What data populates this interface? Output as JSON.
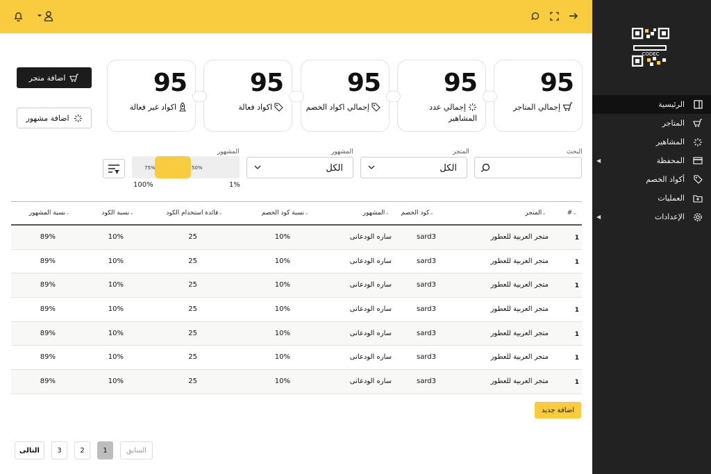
{
  "sidebar": {
    "logo_text": "كودك CODEC",
    "items": [
      {
        "label": "الرئيسية",
        "icon": "layout-icon",
        "active": true
      },
      {
        "label": "المتاجر",
        "icon": "cart-icon"
      },
      {
        "label": "المشاهير",
        "icon": "loader-icon"
      },
      {
        "label": "المحفظة",
        "icon": "wallet-icon",
        "expandable": true
      },
      {
        "label": "أكواد الخصم",
        "icon": "tag-icon"
      },
      {
        "label": "العمليات",
        "icon": "folder-icon"
      },
      {
        "label": "الإعدادات",
        "icon": "gear-icon",
        "expandable": true
      }
    ]
  },
  "header": {
    "icons_right": [
      "arrow-right-icon",
      "fullscreen-icon",
      "search-icon"
    ],
    "icons_left": [
      "user-icon",
      "bell-icon"
    ]
  },
  "cards": [
    {
      "value": "95",
      "label": "إجمالي المتاجر",
      "icon": "cart-icon"
    },
    {
      "value": "95",
      "label": "إجمالي عدد المشاهير",
      "icon": "loader-icon"
    },
    {
      "value": "95",
      "label": "إجمالي اكواد الخصم",
      "icon": "tag-icon"
    },
    {
      "value": "95",
      "label": "اكواد فعالة",
      "icon": "tag-icon"
    },
    {
      "value": "95",
      "label": "اكواد غير فعالة",
      "icon": "rocket-icon"
    }
  ],
  "actions": {
    "add_store": "اضافة متجر",
    "add_celebrity": "اضافة مشهور"
  },
  "filters": {
    "search_label": "البحث",
    "store_label": "المتجر",
    "store_value": "الكل",
    "celebrity_label": "المشهور",
    "celebrity_value": "الكل",
    "range_label": "المشهور",
    "range_low_text": "50%",
    "range_high_text": "75%",
    "range_min": "1%",
    "range_max": "100%"
  },
  "table": {
    "headers": [
      "#",
      "المتجر",
      "كود الخصم",
      "المشهور",
      "نسبة كود الخصم",
      "فائدة استخدام الكود",
      "نسبة الكود",
      "نسبة المشهور"
    ],
    "rows": [
      [
        "1",
        "متجر العربية للعطور",
        "sard3",
        "ساره الودعانى",
        "10%",
        "25",
        "10%",
        "89%"
      ],
      [
        "1",
        "متجر العربية للعطور",
        "sard3",
        "ساره الودعانى",
        "10%",
        "25",
        "10%",
        "89%"
      ],
      [
        "1",
        "متجر العربية للعطور",
        "sard3",
        "ساره الودعانى",
        "10%",
        "25",
        "10%",
        "89%"
      ],
      [
        "1",
        "متجر العربية للعطور",
        "sard3",
        "ساره الودعانى",
        "10%",
        "25",
        "10%",
        "89%"
      ],
      [
        "1",
        "متجر العربية للعطور",
        "sard3",
        "ساره الودعانى",
        "10%",
        "25",
        "10%",
        "89%"
      ],
      [
        "1",
        "متجر العربية للعطور",
        "sard3",
        "ساره الودعانى",
        "10%",
        "25",
        "10%",
        "89%"
      ],
      [
        "1",
        "متجر العربية للعطور",
        "sard3",
        "ساره الودعانى",
        "10%",
        "25",
        "10%",
        "89%"
      ]
    ],
    "add_new": "اضافة جديد"
  },
  "pagination": {
    "prev": "السابق",
    "pages": [
      "1",
      "2",
      "3"
    ],
    "current": "1",
    "next": "التالى"
  },
  "colors": {
    "accent": "#f8cc3e",
    "sidebar": "#222222",
    "dark_button": "#1c1c1c"
  }
}
